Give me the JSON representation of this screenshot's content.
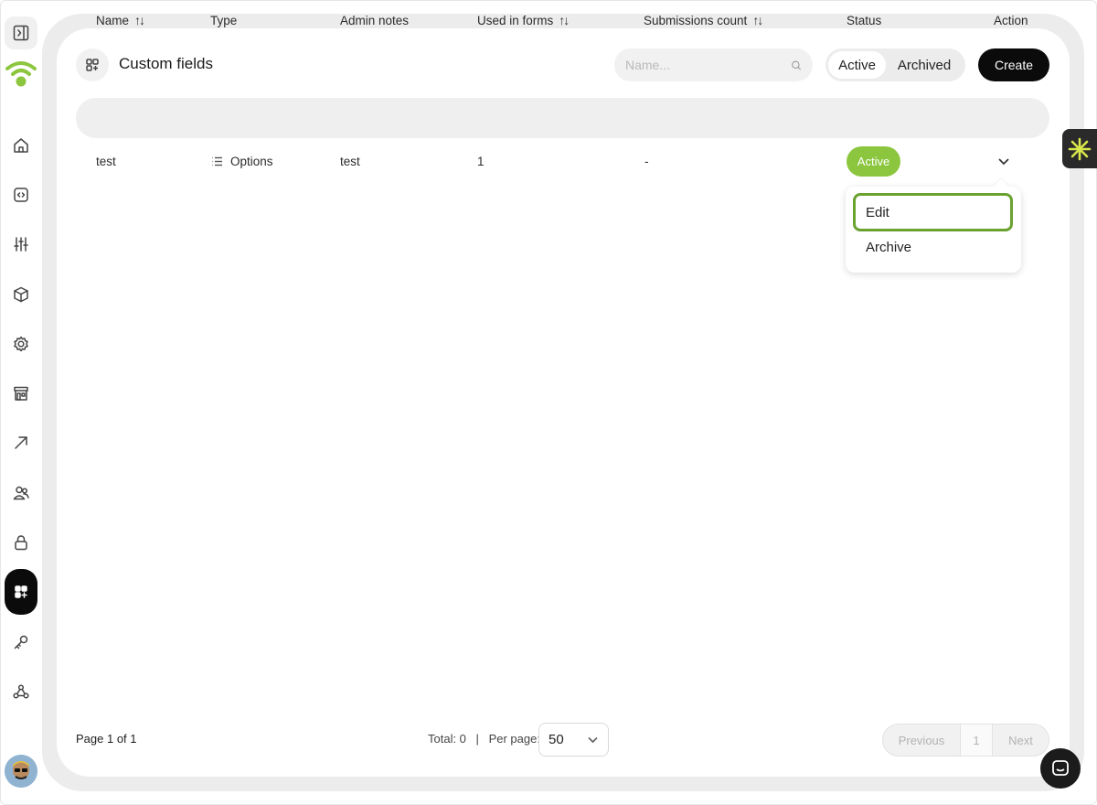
{
  "header": {
    "title": "Custom fields",
    "search_placeholder": "Name...",
    "filter_active": "Active",
    "filter_archived": "Archived",
    "create_label": "Create"
  },
  "table": {
    "columns": {
      "name": "Name",
      "type": "Type",
      "admin_notes": "Admin notes",
      "used_in_forms": "Used in forms",
      "submissions_count": "Submissions count",
      "status": "Status",
      "action": "Action"
    },
    "rows": [
      {
        "name": "test",
        "type": "Options",
        "admin_notes": "test",
        "used_in_forms": "1",
        "submissions_count": "-",
        "status": "Active"
      }
    ]
  },
  "action_menu": {
    "edit": "Edit",
    "archive": "Archive"
  },
  "footer": {
    "page_info": "Page 1 of 1",
    "total": "Total: 0",
    "separator": "|",
    "per_page_label": "Per page:",
    "per_page_value": "50",
    "previous": "Previous",
    "current_page": "1",
    "next": "Next"
  },
  "colors": {
    "accent_green": "#8cc63f",
    "focus_outline": "#6aa230",
    "primary_button": "#0b0b0b"
  },
  "icons": {
    "sidebar": [
      "sidebar-toggle-icon",
      "wifi-logo-icon",
      "home-icon",
      "code-icon",
      "sliders-icon",
      "cube-icon",
      "gear-icon",
      "store-icon",
      "arrow-up-right-icon",
      "users-icon",
      "lock-icon",
      "custom-fields-icon",
      "key-icon",
      "webhook-icon"
    ]
  }
}
